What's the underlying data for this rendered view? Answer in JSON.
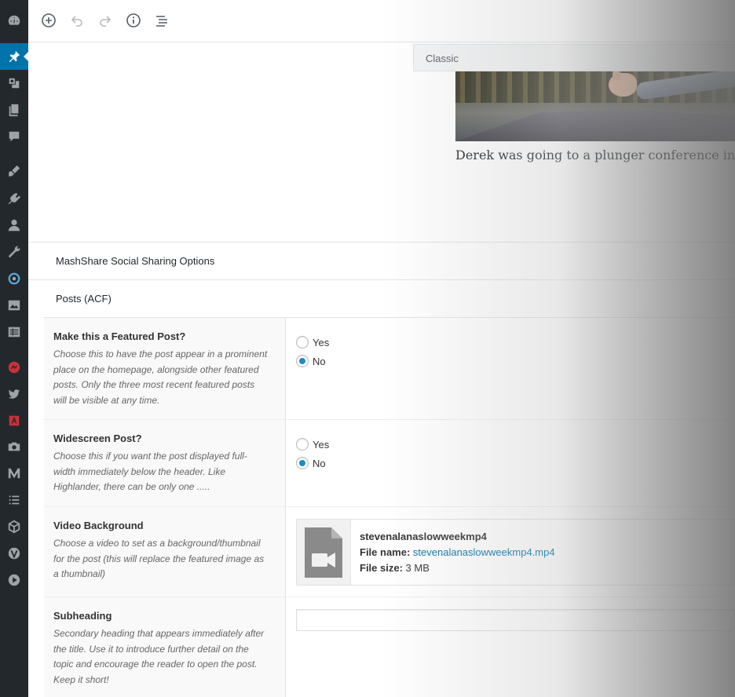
{
  "sidebar": {
    "icons": [
      "dashboard-icon",
      "pin-icon",
      "media-icon",
      "pages-icon",
      "comments-icon",
      "appearance-icon",
      "plugins-icon",
      "users-icon",
      "tools-icon",
      "updraft-icon",
      "gallery-icon",
      "tables-icon",
      "social-icon",
      "twitter-icon",
      "acf-icon",
      "camera-icon",
      "medium-icon",
      "list-icon",
      "cube-icon",
      "visual-composer-icon",
      "play-icon"
    ],
    "active": "pin-icon"
  },
  "toolbar": {
    "buttons": [
      "add-block-icon",
      "undo-icon",
      "redo-icon",
      "info-icon",
      "outline-icon"
    ]
  },
  "editor": {
    "classic_label": "Classic",
    "caption": "Derek was going to a plunger conference in Bar"
  },
  "panels": {
    "mashshare": "MashShare Social Sharing Options",
    "acf": "Posts (ACF)"
  },
  "fields": {
    "featured": {
      "label": "Make this a Featured Post?",
      "desc1": "Choose this to have the post appear in a prominent",
      "desc2": "place on the homepage, alongside other featured",
      "desc3": "posts. Only the three most recent featured posts",
      "desc4": "will be visible at any time.",
      "yes": "Yes",
      "no": "No",
      "selected": "No"
    },
    "widescreen": {
      "label": "Widescreen Post?",
      "desc1": "Choose this if you want the post displayed full-",
      "desc2": "width immediately below the header. Like",
      "desc3": "Highlander, there can be only one .....",
      "yes": "Yes",
      "no": "No",
      "selected": "No"
    },
    "video": {
      "label": "Video Background",
      "desc1": "Choose a video to set as a background/thumbnail",
      "desc2": "for the post (this will replace the featured image as",
      "desc3": "a thumbnail)",
      "file_title": "stevenalanaslowweekmp4",
      "file_name_label": "File name:",
      "file_name": "stevenalanaslowweekmp4.mp4",
      "file_size_label": "File size:",
      "file_size": "3 MB"
    },
    "subheading": {
      "label": "Subheading",
      "desc1": "Secondary heading that appears immediately after",
      "desc2": "the title. Use it to introduce further detail on the",
      "desc3": "topic and encourage the reader to open the post.",
      "desc4": "Keep it short!",
      "value": ""
    }
  },
  "colors": {
    "sidebar_bg": "#23282d",
    "accent": "#0073aa"
  }
}
